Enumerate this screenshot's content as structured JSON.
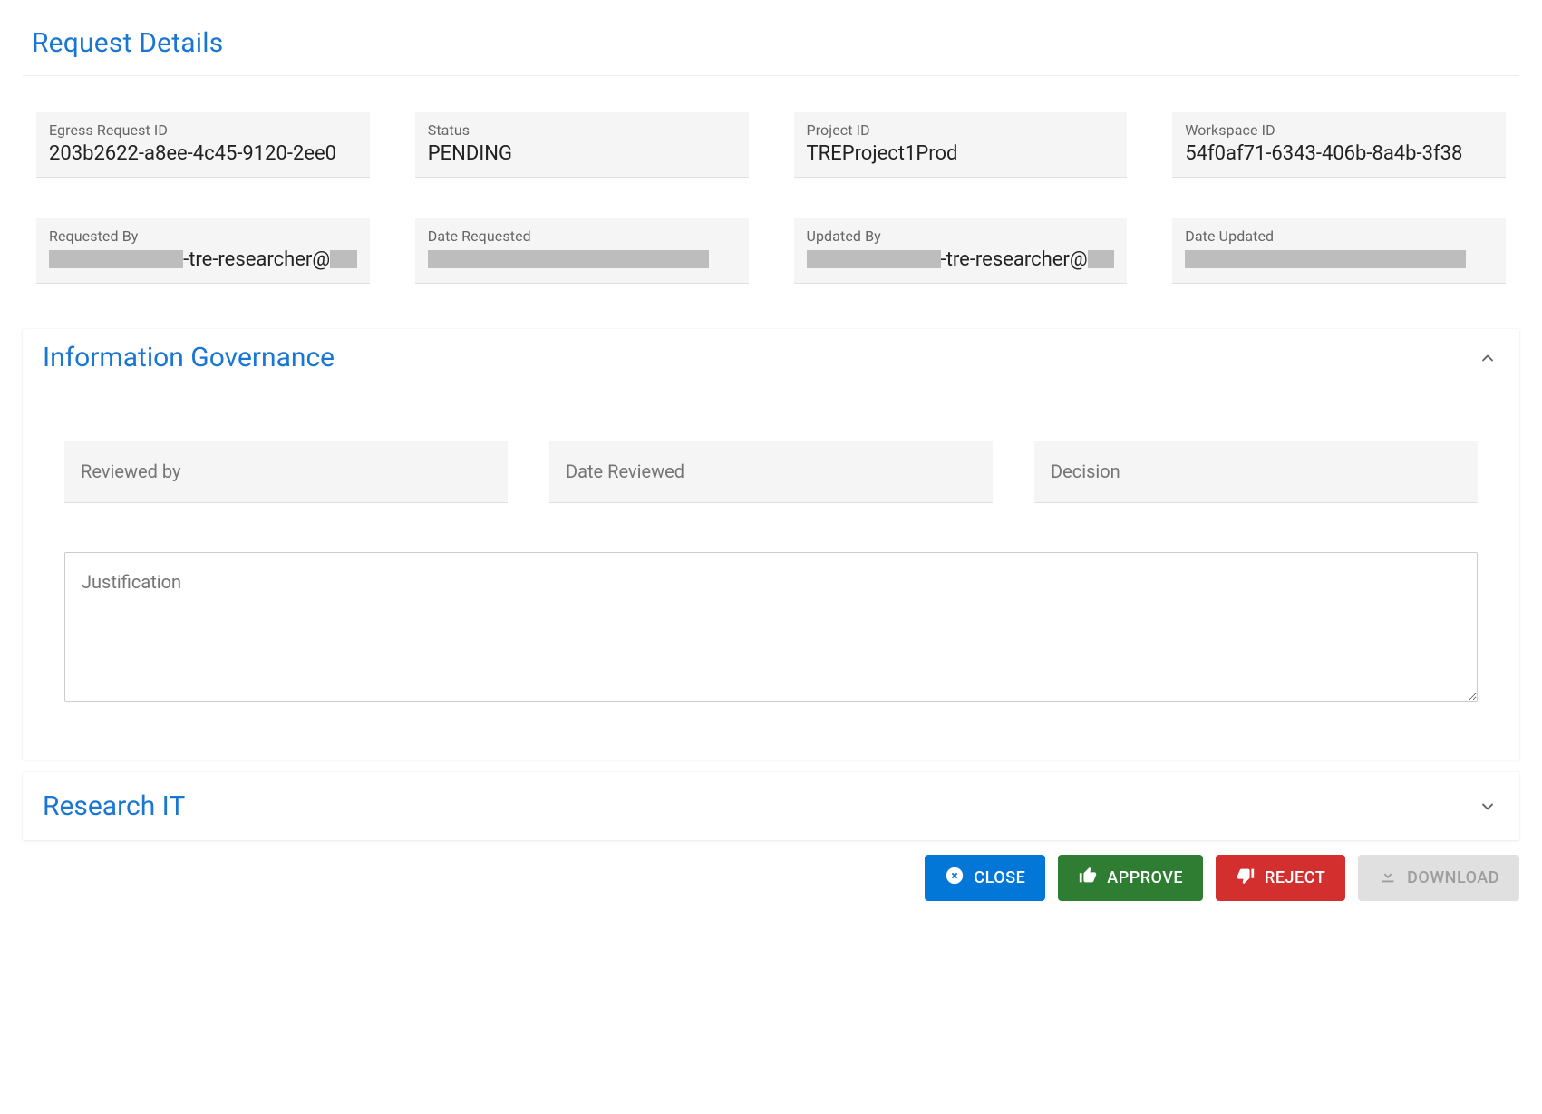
{
  "title": "Request Details",
  "fields": {
    "egress_id": {
      "label": "Egress Request ID",
      "value": "203b2622-a8ee-4c45-9120-2ee0"
    },
    "status": {
      "label": "Status",
      "value": "PENDING"
    },
    "project": {
      "label": "Project ID",
      "value": "TREProject1Prod"
    },
    "workspace": {
      "label": "Workspace ID",
      "value": "54f0af71-6343-406b-8a4b-3f38"
    },
    "requested_by": {
      "label": "Requested By",
      "value_suffix": "-tre-researcher@"
    },
    "date_requested": {
      "label": "Date Requested"
    },
    "updated_by": {
      "label": "Updated By",
      "value_suffix": "-tre-researcher@"
    },
    "date_updated": {
      "label": "Date Updated"
    }
  },
  "ig": {
    "title": "Information Governance",
    "reviewed_by_placeholder": "Reviewed by",
    "date_reviewed_placeholder": "Date Reviewed",
    "decision_placeholder": "Decision",
    "justification_placeholder": "Justification"
  },
  "research_it": {
    "title": "Research IT"
  },
  "buttons": {
    "close": "CLOSE",
    "approve": "APPROVE",
    "reject": "REJECT",
    "download": "DOWNLOAD"
  }
}
